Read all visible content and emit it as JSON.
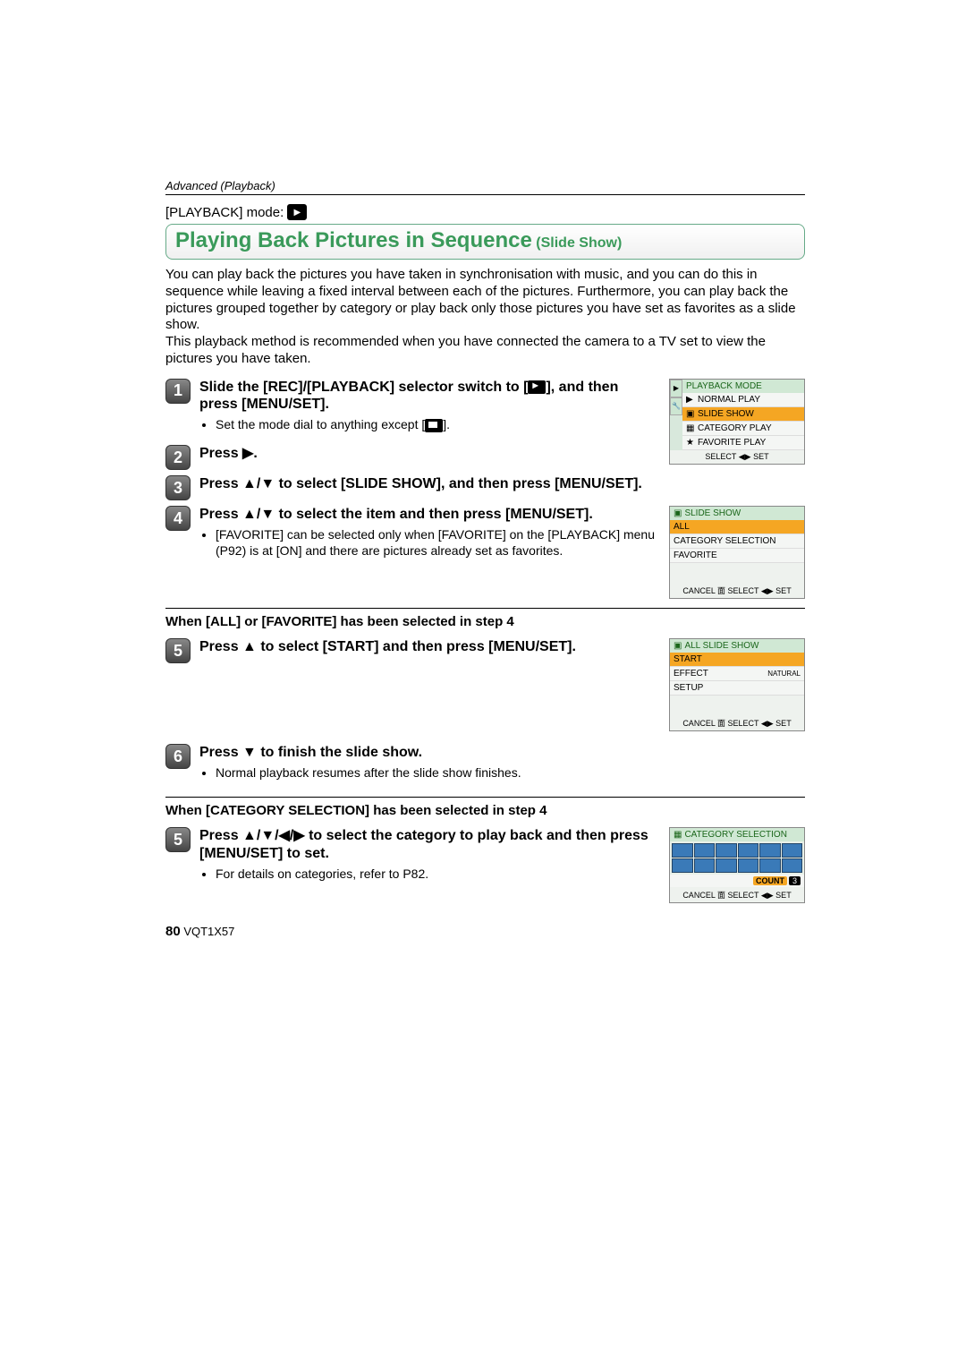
{
  "header": {
    "section": "Advanced (Playback)"
  },
  "mode_line": {
    "label": "[PLAYBACK] mode:"
  },
  "title": {
    "main": "Playing Back Pictures in Sequence",
    "sub": " (Slide Show)"
  },
  "intro": "You can play back the pictures you have taken in synchronisation with music, and you can do this in sequence while leaving a fixed interval between each of the pictures. Furthermore, you can play back the pictures grouped together by category or play back only those pictures you have set as favorites as a slide show.\nThis playback method is recommended when you have connected the camera to a TV set to view the pictures you have taken.",
  "steps": {
    "s1": {
      "num": "1",
      "title_a": "Slide the [REC]/[PLAYBACK] selector switch to [",
      "title_b": "], and then press [MENU/SET].",
      "bullet": "Set the mode dial to anything except ["
    },
    "s2": {
      "num": "2",
      "title": "Press ▶."
    },
    "s3": {
      "num": "3",
      "title": "Press ▲/▼ to select [SLIDE SHOW], and then press [MENU/SET]."
    },
    "s4": {
      "num": "4",
      "title": "Press ▲/▼ to select the item and then press [MENU/SET].",
      "bullet": "[FAVORITE] can be selected only when [FAVORITE] on the [PLAYBACK] menu (P92) is at [ON] and there are pictures already set as favorites."
    },
    "s5": {
      "num": "5",
      "title": "Press ▲ to select [START] and then press [MENU/SET]."
    },
    "s6": {
      "num": "6",
      "title": "Press ▼ to finish the slide show.",
      "bullet": "Normal playback resumes after the slide show finishes."
    },
    "s5b": {
      "num": "5",
      "title": "Press ▲/▼/◀/▶ to select the category to play back and then press [MENU/SET] to set.",
      "bullet": "For details on categories, refer to P82."
    }
  },
  "subsections": {
    "a": "When [ALL] or [FAVORITE] has been selected in step 4",
    "b": "When [CATEGORY SELECTION] has been selected in step 4"
  },
  "screens": {
    "playback_mode": {
      "header": "PLAYBACK MODE",
      "items": [
        "NORMAL PLAY",
        "SLIDE SHOW",
        "CATEGORY PLAY",
        "FAVORITE PLAY"
      ],
      "footer": "SELECT ◀▶ SET"
    },
    "slide_show": {
      "header": "SLIDE SHOW",
      "items": [
        "ALL",
        "CATEGORY SELECTION",
        "FAVORITE"
      ],
      "footer": "CANCEL 面 SELECT ◀▶ SET"
    },
    "all_slide_show": {
      "header": "ALL SLIDE SHOW",
      "items": [
        "START",
        "EFFECT",
        "SETUP"
      ],
      "right": "NATURAL",
      "footer": "CANCEL 面 SELECT ◀▶ SET"
    },
    "category_selection": {
      "header": "CATEGORY SELECTION",
      "count_label": "COUNT",
      "count_value": "3",
      "footer": "CANCEL 面 SELECT ◀▶ SET"
    }
  },
  "footer": {
    "page": "80",
    "doc": "VQT1X57"
  }
}
